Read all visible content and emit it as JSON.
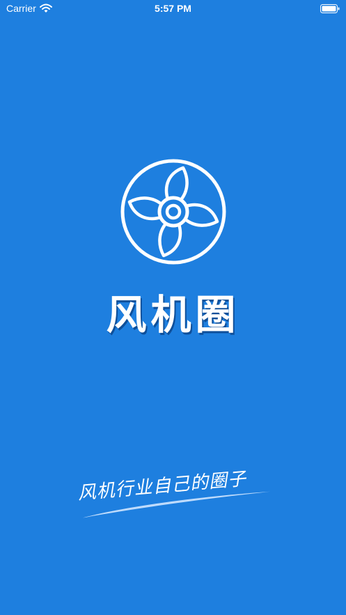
{
  "status_bar": {
    "carrier": "Carrier",
    "time": "5:57 PM"
  },
  "splash": {
    "app_name": "风机圈",
    "slogan": "风机行业自己的圈子"
  },
  "icons": {
    "logo": "fan-logo-icon",
    "wifi": "wifi-icon",
    "battery": "battery-icon"
  },
  "colors": {
    "background": "#1e7fdf",
    "foreground": "#ffffff"
  }
}
